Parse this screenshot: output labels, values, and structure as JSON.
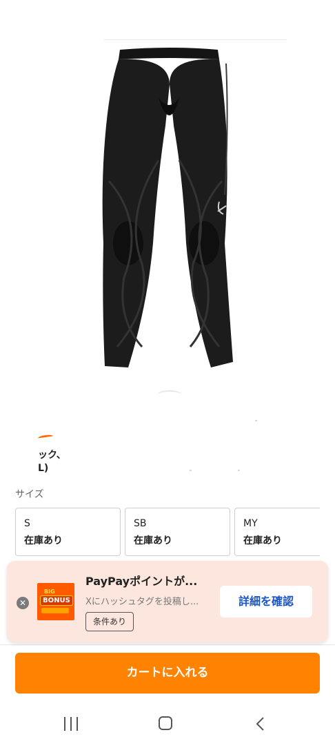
{
  "product": {
    "title_fragment_1": "ック、",
    "title_fragment_2": "L)"
  },
  "size_section": {
    "label": "サイズ",
    "options": [
      {
        "name": "S",
        "stock": "在庫あり"
      },
      {
        "name": "SB",
        "stock": "在庫あり"
      },
      {
        "name": "MY",
        "stock": "在庫あり"
      }
    ]
  },
  "promo": {
    "thumb_text_top": "BIG",
    "thumb_text_main": "BONUS",
    "title": "PayPayポイントが...",
    "subtitle": "Xにハッシュタグを投稿し...",
    "condition_label": "条件あり",
    "detail_button": "詳細を確認",
    "close_icon": "close-icon"
  },
  "cart": {
    "button_label": "カートに入れる"
  },
  "navbar": {
    "recent_icon": "recent-apps-icon",
    "home_icon": "home-icon",
    "back_icon": "back-icon"
  },
  "colors": {
    "accent": "#ff8200",
    "promo_bg": "#fde6de",
    "link_blue": "#1a56c8"
  }
}
